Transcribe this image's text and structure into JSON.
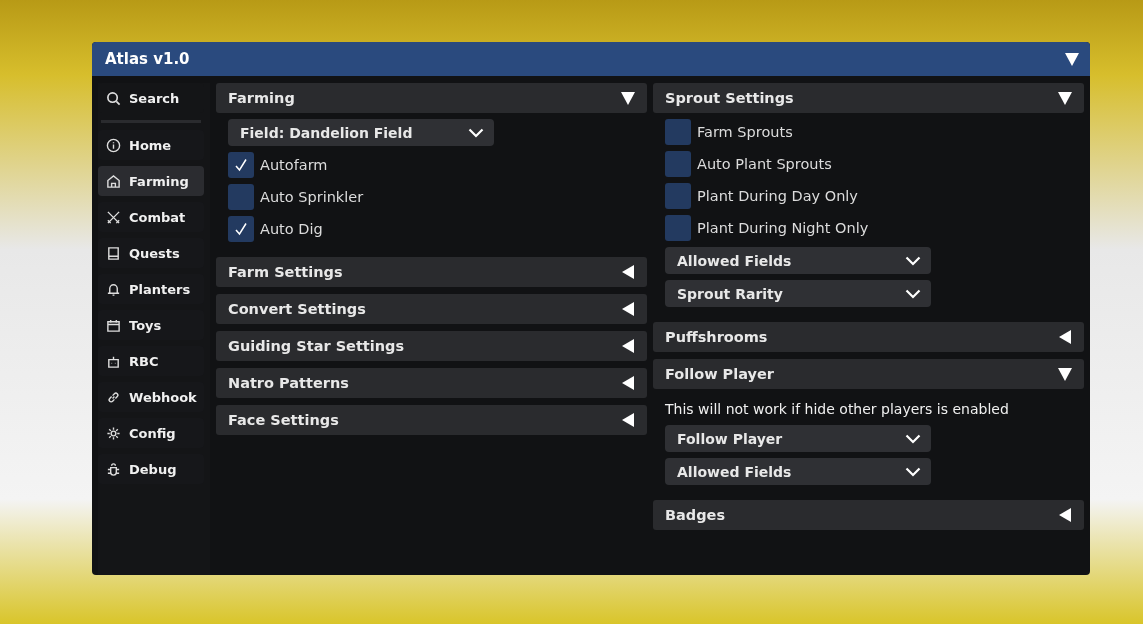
{
  "window": {
    "title": "Atlas v1.0",
    "expanded": true
  },
  "sidebar": {
    "search": {
      "label": "Search"
    },
    "items": [
      {
        "label": "Home",
        "selected": false
      },
      {
        "label": "Farming",
        "selected": true
      },
      {
        "label": "Combat",
        "selected": false
      },
      {
        "label": "Quests",
        "selected": false
      },
      {
        "label": "Planters",
        "selected": false
      },
      {
        "label": "Toys",
        "selected": false
      },
      {
        "label": "RBC",
        "selected": false
      },
      {
        "label": "Webhook",
        "selected": false
      },
      {
        "label": "Config",
        "selected": false
      },
      {
        "label": "Debug",
        "selected": false
      }
    ]
  },
  "columns": [
    [
      {
        "title": "Farming",
        "expanded": true,
        "items": [
          {
            "kind": "dropdown",
            "label": "Field: Dandelion Field"
          },
          {
            "kind": "checkbox",
            "label": "Autofarm",
            "checked": true
          },
          {
            "kind": "checkbox",
            "label": "Auto Sprinkler",
            "checked": false
          },
          {
            "kind": "checkbox",
            "label": "Auto Dig",
            "checked": true
          }
        ]
      },
      {
        "title": "Farm Settings",
        "expanded": false
      },
      {
        "title": "Convert Settings",
        "expanded": false
      },
      {
        "title": "Guiding Star Settings",
        "expanded": false
      },
      {
        "title": "Natro Patterns",
        "expanded": false
      },
      {
        "title": "Face Settings",
        "expanded": false
      }
    ],
    [
      {
        "title": "Sprout Settings",
        "expanded": true,
        "items": [
          {
            "kind": "checkbox",
            "label": "Farm Sprouts",
            "checked": false
          },
          {
            "kind": "checkbox",
            "label": "Auto Plant Sprouts",
            "checked": false
          },
          {
            "kind": "checkbox",
            "label": "Plant During Day Only",
            "checked": false
          },
          {
            "kind": "checkbox",
            "label": "Plant During Night Only",
            "checked": false
          },
          {
            "kind": "dropdown",
            "label": "Allowed Fields"
          },
          {
            "kind": "dropdown",
            "label": "Sprout Rarity"
          }
        ]
      },
      {
        "title": "Puffshrooms",
        "expanded": false
      },
      {
        "title": "Follow Player",
        "expanded": true,
        "items": [
          {
            "kind": "note",
            "label": "This will not work if hide other players is enabled"
          },
          {
            "kind": "dropdown",
            "label": "Follow Player"
          },
          {
            "kind": "dropdown",
            "label": "Allowed Fields"
          }
        ]
      },
      {
        "title": "Badges",
        "expanded": false
      }
    ]
  ]
}
